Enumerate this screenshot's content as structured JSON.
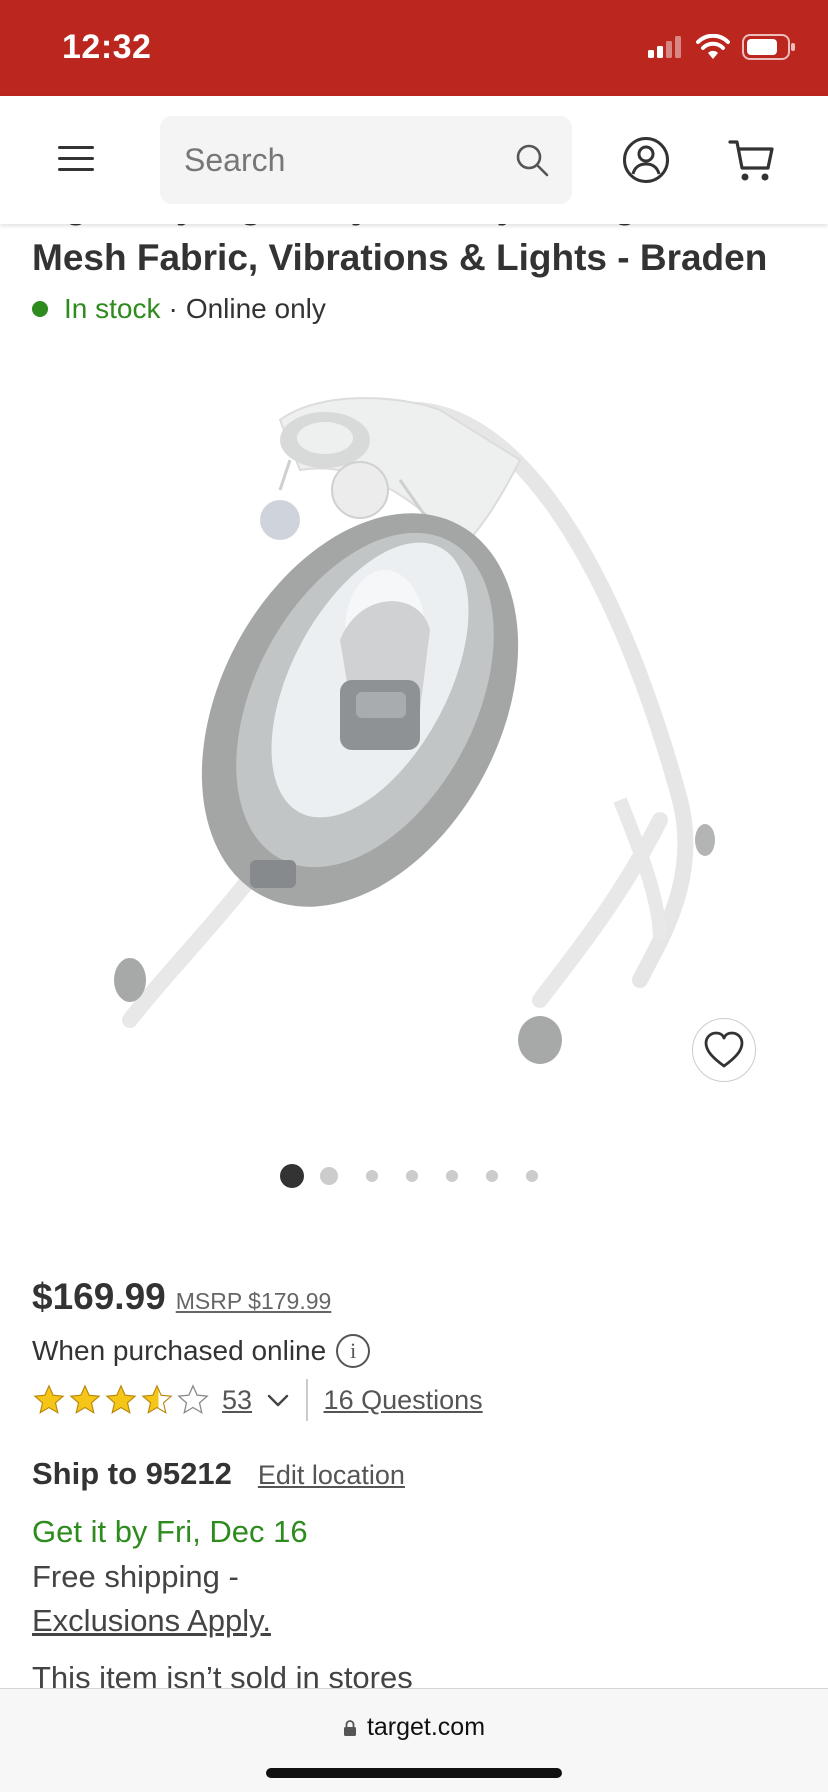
{
  "status_bar": {
    "time": "12:32",
    "colors": {
      "background": "#bb261f",
      "text": "#ffffff"
    },
    "icons": [
      "cellular-signal-icon",
      "wifi-icon",
      "battery-icon"
    ]
  },
  "nav": {
    "menu_icon": "hamburger-menu-icon",
    "search": {
      "placeholder": "Search",
      "value": ""
    },
    "search_icon": "search-icon",
    "account_icon": "account-icon",
    "cart_icon": "cart-icon"
  },
  "product": {
    "title_line1": "Ingenuity Ingenuity Dreamy Swing",
    "title_line2": "Mesh Fabric, Vibrations & Lights - Braden",
    "stock_status": "In stock",
    "separator": "·",
    "availability": "Online only",
    "image_alt": "Gray baby swing with canopy and hanging toys",
    "favorite_icon": "heart-icon",
    "carousel": {
      "total": 7,
      "active": 1
    },
    "price": "$169.99",
    "msrp": "MSRP $179.99",
    "purchased_text": "When purchased online",
    "info_icon": "i",
    "rating": {
      "stars": 3.5,
      "max": 5,
      "count": "53"
    },
    "questions": "16 Questions"
  },
  "shipping": {
    "ship_to": "Ship to 95212",
    "edit_location": "Edit location",
    "get_it_by": "Get it by Fri, Dec 16",
    "free_shipping": "Free shipping -",
    "exclusions": "Exclusions Apply.",
    "not_sold": "This item isn’t sold in stores"
  },
  "browser": {
    "url": "target.com",
    "lock_icon": "lock-icon"
  },
  "colors": {
    "brand_red": "#bb261f",
    "in_stock_green": "#2e8b1e",
    "star_gold": "#f5c518",
    "text_dark": "#333333"
  }
}
